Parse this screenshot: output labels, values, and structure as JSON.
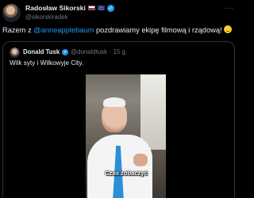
{
  "post": {
    "author_name": "Radosław Sikorski",
    "author_handle": "@sikorskiradek",
    "more_label": "···",
    "text_before": "Razem z ",
    "mention": "@anneapplebaum",
    "text_after": " pozdrawiamy ekipę filmową i rządową! "
  },
  "quoted_post": {
    "author_name": "Donald Tusk",
    "author_handle": "@donaldtusk",
    "time": "· 15 g.",
    "text": "Wilk syty i Wilkowyje City.",
    "video_caption": "Czas zobaczyć"
  },
  "colors": {
    "background": "#000000",
    "text": "#e7e9ea",
    "muted": "#71767b",
    "link": "#1d9bf0",
    "verified": "#1d9bf0",
    "border": "#2f3336"
  }
}
